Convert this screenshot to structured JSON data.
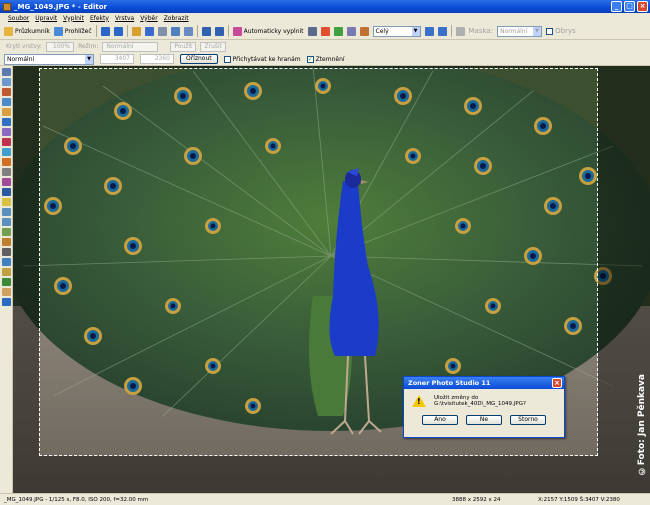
{
  "window": {
    "title": "_MG_1049.JPG * - Editor",
    "min": "_",
    "max": "□",
    "close": "×"
  },
  "menu": [
    "Soubor",
    "Upravit",
    "Vyplnit",
    "Efekty",
    "Vrstva",
    "Výběr",
    "Zobrazit"
  ],
  "toolbar": {
    "pruzkumnik": "Průzkumník",
    "prohlizec": "Prohlížeč",
    "auto_fill": "Automaticky vyplnit",
    "zoom_value": "Celý",
    "mask_label": "Maska:",
    "mask_value": "Normální",
    "obrys": "Obrys"
  },
  "toolbar2": {
    "kryti_label": "Krytí vrstvy:",
    "kryti_value": "100%",
    "rezim_label": "Režim:",
    "rezim_value": "Normální",
    "pouzit": "Použít",
    "zrusit": "Zrušit"
  },
  "toolbar3": {
    "mode_value": "Normální",
    "width_value": "3407",
    "height_value": "2360",
    "crop_button": "Oříznout",
    "snap_label": "Přichytávat ke hranám",
    "darken_label": "Ztemnění",
    "snap_checked": false,
    "darken_checked": true
  },
  "watermark": "©Foto: Jan Pěnkava",
  "dialog": {
    "title": "Zoner Photo Studio 11",
    "message": "Uložit změny do G:\\tvisitutek_40D\\_MG_1049.JPG?",
    "yes": "Ano",
    "no": "Ne",
    "cancel": "Storno"
  },
  "status": {
    "file_info": "_MG_1049.JPG - 1/125 s, F8.0, ISO 200, f=32.00 mm",
    "dimensions": "3888 x 2592 x 24",
    "coords": "X:2157 Y:1509 Š:3407 V:2380"
  }
}
